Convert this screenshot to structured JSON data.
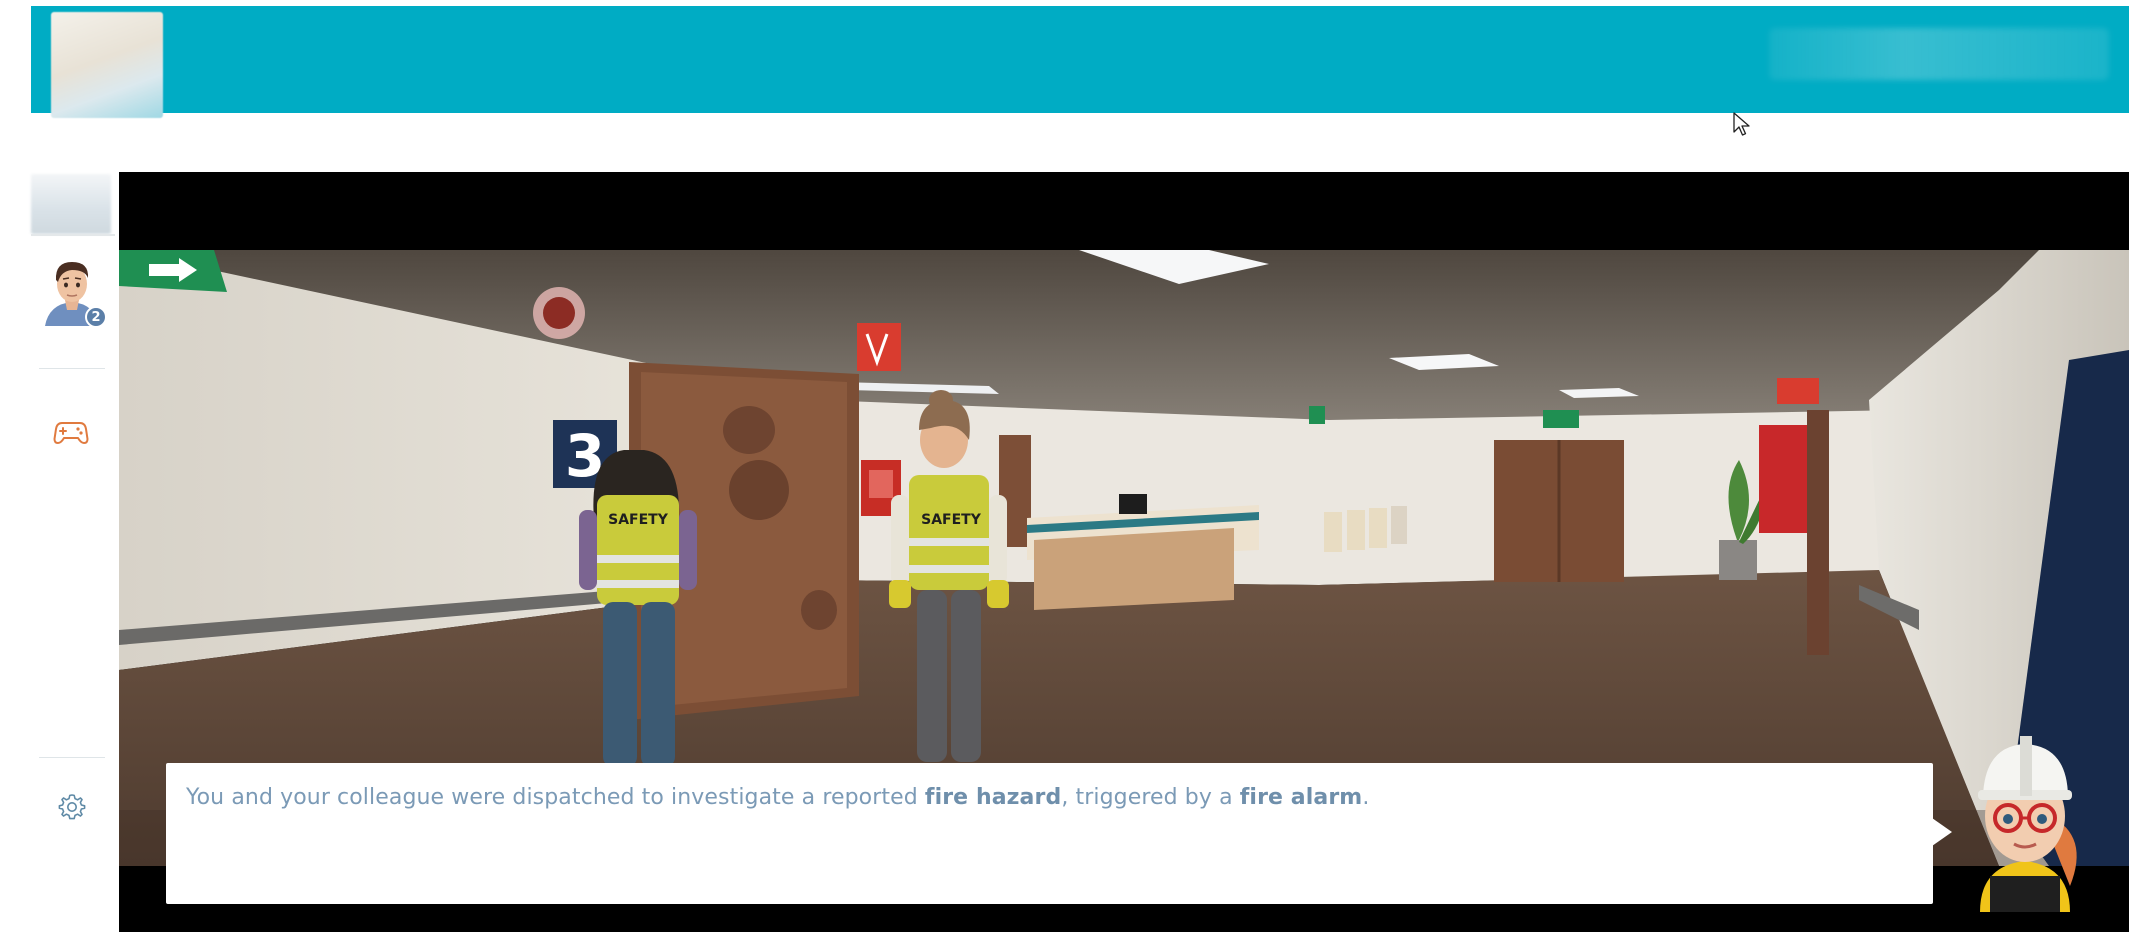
{
  "header": {
    "logo_icon": "app-logo",
    "right_icon": "blurred-account-area"
  },
  "sidebar": {
    "thumbnail_icon": "blurred-thumbnail",
    "avatar_icon": "user-avatar",
    "avatar_badge": "2",
    "items": [
      {
        "icon": "gamepad-icon"
      },
      {
        "icon": "gear-icon"
      }
    ]
  },
  "scene": {
    "room_number": "3",
    "vest_label_left": "SAFETY",
    "vest_label_right": "SAFETY"
  },
  "dialogue": {
    "text_part1": "You and your colleague were dispatched to investigate a reported ",
    "highlight1": "fire hazard",
    "text_part2": ", triggered by a ",
    "highlight2": "fire alarm",
    "text_part3": "."
  },
  "colors": {
    "header_bg": "#00acc4",
    "accent_orange": "#e07a3f",
    "dialogue_text": "#7b9ab6",
    "icon_grey": "#5f8aa6"
  }
}
